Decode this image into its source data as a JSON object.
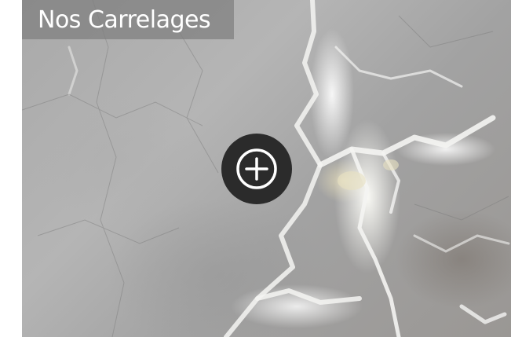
{
  "header": {
    "title": "Nos Carrelages"
  },
  "actions": {
    "expand_icon": "plus-circle-icon"
  },
  "colors": {
    "button_bg": "#2b2b2b",
    "title_bg": "#808080",
    "title_text": "#ffffff"
  }
}
